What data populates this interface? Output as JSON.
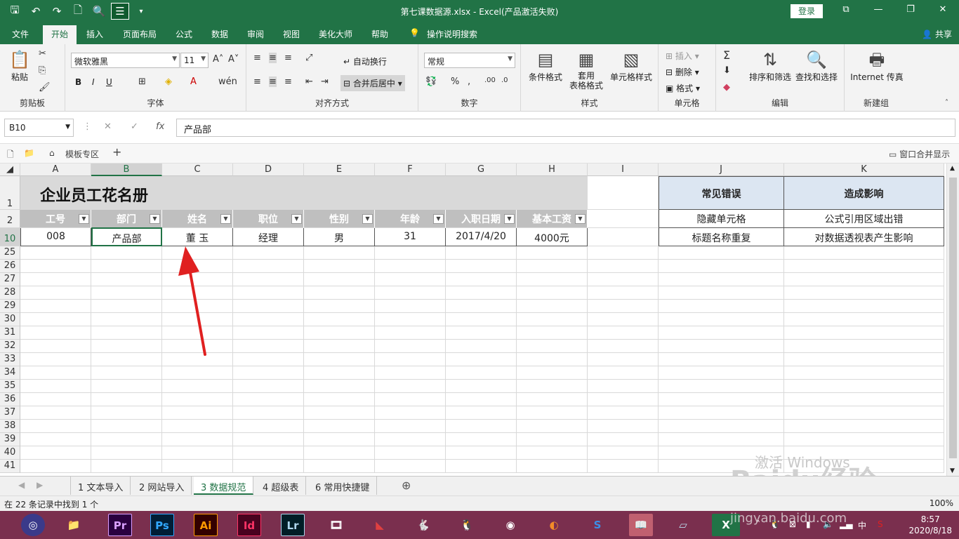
{
  "window": {
    "title": "第七课数据源.xlsx  -  Excel(产品激活失败)",
    "login_label": "登录",
    "controls": [
      "⧉",
      "—",
      "❐",
      "✕"
    ]
  },
  "ribbon_tabs": [
    "文件",
    "开始",
    "插入",
    "页面布局",
    "公式",
    "数据",
    "审阅",
    "视图",
    "美化大师",
    "帮助",
    "操作说明搜索"
  ],
  "share_label": "共享",
  "ribbon": {
    "clipboard": {
      "paste": "粘贴",
      "label": "剪贴板"
    },
    "font": {
      "name": "微软雅黑",
      "size": "11",
      "label": "字体",
      "bold": "B",
      "italic": "I",
      "underline": "U"
    },
    "alignment": {
      "wrap": "自动换行",
      "merge": "合并后居中",
      "label": "对齐方式"
    },
    "number": {
      "format": "常规",
      "label": "数字"
    },
    "styles": {
      "conditional": "条件格式",
      "table_format": "套用\n表格格式",
      "cell_styles": "单元格样式",
      "label": "样式"
    },
    "cells": {
      "insert": "插入",
      "delete": "删除",
      "format": "格式",
      "label": "单元格"
    },
    "editing": {
      "sort": "排序和筛选",
      "find": "查找和选择",
      "label": "编辑"
    },
    "newgroup": {
      "internet": "Internet 传真",
      "label": "新建组"
    }
  },
  "formula_bar": {
    "name_box": "B10",
    "formula": "产品部"
  },
  "doc_bar": {
    "template_zone": "模板专区",
    "window_merge": "窗口合并显示"
  },
  "columns": [
    "A",
    "B",
    "C",
    "D",
    "E",
    "F",
    "G",
    "H",
    "I",
    "J",
    "K"
  ],
  "rows": [
    "1",
    "2",
    "10",
    "25",
    "26",
    "27",
    "28",
    "29",
    "30",
    "31",
    "32",
    "33",
    "34",
    "35",
    "36",
    "37",
    "38",
    "39",
    "40",
    "41"
  ],
  "sheet": {
    "title": "企业员工花名册",
    "headers": [
      "工号",
      "部门",
      "姓名",
      "职位",
      "性别",
      "年龄",
      "入职日期",
      "基本工资"
    ],
    "record": [
      "008",
      "产品部",
      "董    玉",
      "经理",
      "男",
      "31",
      "2017/4/20",
      "4000元"
    ],
    "side_table": {
      "headers": [
        "常见错误",
        "造成影响"
      ],
      "rows": [
        [
          "隐藏单元格",
          "公式引用区域出错"
        ],
        [
          "标题名称重复",
          "对数据透视表产生影响"
        ]
      ]
    }
  },
  "sheet_tabs": [
    "1 文本导入",
    "2 网站导入",
    "3 数据规范",
    "4 超级表",
    "6 常用快捷键"
  ],
  "active_sheet": "3 数据规范",
  "status": {
    "message": "在 22 条记录中找到 1 个",
    "zoom": "100%"
  },
  "taskbar": {
    "apps": [
      "Pr",
      "Ps",
      "Ai",
      "Id",
      "Lr"
    ],
    "time": "8:57",
    "date": "2020/8/18",
    "ime": "中"
  },
  "watermark": {
    "text1": "激活 Windows",
    "text2": "Baidu经验",
    "text3": "jingyan.baidu.com"
  }
}
